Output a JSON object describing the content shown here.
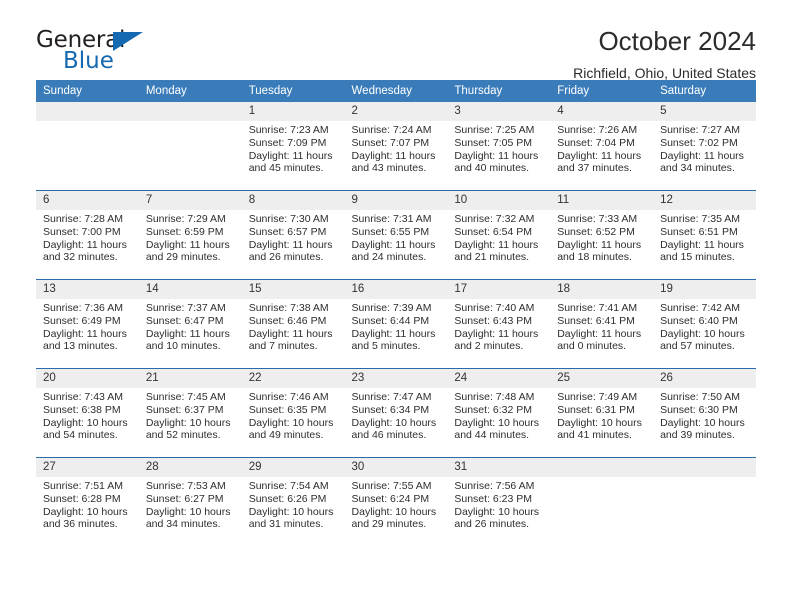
{
  "logo": {
    "word_one": "General",
    "word_two": "Blue",
    "triangle_icon": "triangle-icon",
    "blue": "#1569b0"
  },
  "header": {
    "title": "October 2024",
    "location": "Richfield, Ohio, United States"
  },
  "theme": {
    "header_blue": "#3a7cba",
    "row_rule_blue": "#2b6ca8",
    "daynum_gray": "#eeeeee"
  },
  "calendar": {
    "weekday_headers": [
      "Sunday",
      "Monday",
      "Tuesday",
      "Wednesday",
      "Thursday",
      "Friday",
      "Saturday"
    ],
    "weeks": [
      [
        {
          "day": "",
          "sunrise": "",
          "sunset": "",
          "daylight_a": "",
          "daylight_b": "",
          "empty": true
        },
        {
          "day": "",
          "sunrise": "",
          "sunset": "",
          "daylight_a": "",
          "daylight_b": "",
          "empty": true
        },
        {
          "day": "1",
          "sunrise": "Sunrise: 7:23 AM",
          "sunset": "Sunset: 7:09 PM",
          "daylight_a": "Daylight: 11 hours",
          "daylight_b": "and 45 minutes."
        },
        {
          "day": "2",
          "sunrise": "Sunrise: 7:24 AM",
          "sunset": "Sunset: 7:07 PM",
          "daylight_a": "Daylight: 11 hours",
          "daylight_b": "and 43 minutes."
        },
        {
          "day": "3",
          "sunrise": "Sunrise: 7:25 AM",
          "sunset": "Sunset: 7:05 PM",
          "daylight_a": "Daylight: 11 hours",
          "daylight_b": "and 40 minutes."
        },
        {
          "day": "4",
          "sunrise": "Sunrise: 7:26 AM",
          "sunset": "Sunset: 7:04 PM",
          "daylight_a": "Daylight: 11 hours",
          "daylight_b": "and 37 minutes."
        },
        {
          "day": "5",
          "sunrise": "Sunrise: 7:27 AM",
          "sunset": "Sunset: 7:02 PM",
          "daylight_a": "Daylight: 11 hours",
          "daylight_b": "and 34 minutes."
        }
      ],
      [
        {
          "day": "6",
          "sunrise": "Sunrise: 7:28 AM",
          "sunset": "Sunset: 7:00 PM",
          "daylight_a": "Daylight: 11 hours",
          "daylight_b": "and 32 minutes."
        },
        {
          "day": "7",
          "sunrise": "Sunrise: 7:29 AM",
          "sunset": "Sunset: 6:59 PM",
          "daylight_a": "Daylight: 11 hours",
          "daylight_b": "and 29 minutes."
        },
        {
          "day": "8",
          "sunrise": "Sunrise: 7:30 AM",
          "sunset": "Sunset: 6:57 PM",
          "daylight_a": "Daylight: 11 hours",
          "daylight_b": "and 26 minutes."
        },
        {
          "day": "9",
          "sunrise": "Sunrise: 7:31 AM",
          "sunset": "Sunset: 6:55 PM",
          "daylight_a": "Daylight: 11 hours",
          "daylight_b": "and 24 minutes."
        },
        {
          "day": "10",
          "sunrise": "Sunrise: 7:32 AM",
          "sunset": "Sunset: 6:54 PM",
          "daylight_a": "Daylight: 11 hours",
          "daylight_b": "and 21 minutes."
        },
        {
          "day": "11",
          "sunrise": "Sunrise: 7:33 AM",
          "sunset": "Sunset: 6:52 PM",
          "daylight_a": "Daylight: 11 hours",
          "daylight_b": "and 18 minutes."
        },
        {
          "day": "12",
          "sunrise": "Sunrise: 7:35 AM",
          "sunset": "Sunset: 6:51 PM",
          "daylight_a": "Daylight: 11 hours",
          "daylight_b": "and 15 minutes."
        }
      ],
      [
        {
          "day": "13",
          "sunrise": "Sunrise: 7:36 AM",
          "sunset": "Sunset: 6:49 PM",
          "daylight_a": "Daylight: 11 hours",
          "daylight_b": "and 13 minutes."
        },
        {
          "day": "14",
          "sunrise": "Sunrise: 7:37 AM",
          "sunset": "Sunset: 6:47 PM",
          "daylight_a": "Daylight: 11 hours",
          "daylight_b": "and 10 minutes."
        },
        {
          "day": "15",
          "sunrise": "Sunrise: 7:38 AM",
          "sunset": "Sunset: 6:46 PM",
          "daylight_a": "Daylight: 11 hours",
          "daylight_b": "and 7 minutes."
        },
        {
          "day": "16",
          "sunrise": "Sunrise: 7:39 AM",
          "sunset": "Sunset: 6:44 PM",
          "daylight_a": "Daylight: 11 hours",
          "daylight_b": "and 5 minutes."
        },
        {
          "day": "17",
          "sunrise": "Sunrise: 7:40 AM",
          "sunset": "Sunset: 6:43 PM",
          "daylight_a": "Daylight: 11 hours",
          "daylight_b": "and 2 minutes."
        },
        {
          "day": "18",
          "sunrise": "Sunrise: 7:41 AM",
          "sunset": "Sunset: 6:41 PM",
          "daylight_a": "Daylight: 11 hours",
          "daylight_b": "and 0 minutes."
        },
        {
          "day": "19",
          "sunrise": "Sunrise: 7:42 AM",
          "sunset": "Sunset: 6:40 PM",
          "daylight_a": "Daylight: 10 hours",
          "daylight_b": "and 57 minutes."
        }
      ],
      [
        {
          "day": "20",
          "sunrise": "Sunrise: 7:43 AM",
          "sunset": "Sunset: 6:38 PM",
          "daylight_a": "Daylight: 10 hours",
          "daylight_b": "and 54 minutes."
        },
        {
          "day": "21",
          "sunrise": "Sunrise: 7:45 AM",
          "sunset": "Sunset: 6:37 PM",
          "daylight_a": "Daylight: 10 hours",
          "daylight_b": "and 52 minutes."
        },
        {
          "day": "22",
          "sunrise": "Sunrise: 7:46 AM",
          "sunset": "Sunset: 6:35 PM",
          "daylight_a": "Daylight: 10 hours",
          "daylight_b": "and 49 minutes."
        },
        {
          "day": "23",
          "sunrise": "Sunrise: 7:47 AM",
          "sunset": "Sunset: 6:34 PM",
          "daylight_a": "Daylight: 10 hours",
          "daylight_b": "and 46 minutes."
        },
        {
          "day": "24",
          "sunrise": "Sunrise: 7:48 AM",
          "sunset": "Sunset: 6:32 PM",
          "daylight_a": "Daylight: 10 hours",
          "daylight_b": "and 44 minutes."
        },
        {
          "day": "25",
          "sunrise": "Sunrise: 7:49 AM",
          "sunset": "Sunset: 6:31 PM",
          "daylight_a": "Daylight: 10 hours",
          "daylight_b": "and 41 minutes."
        },
        {
          "day": "26",
          "sunrise": "Sunrise: 7:50 AM",
          "sunset": "Sunset: 6:30 PM",
          "daylight_a": "Daylight: 10 hours",
          "daylight_b": "and 39 minutes."
        }
      ],
      [
        {
          "day": "27",
          "sunrise": "Sunrise: 7:51 AM",
          "sunset": "Sunset: 6:28 PM",
          "daylight_a": "Daylight: 10 hours",
          "daylight_b": "and 36 minutes."
        },
        {
          "day": "28",
          "sunrise": "Sunrise: 7:53 AM",
          "sunset": "Sunset: 6:27 PM",
          "daylight_a": "Daylight: 10 hours",
          "daylight_b": "and 34 minutes."
        },
        {
          "day": "29",
          "sunrise": "Sunrise: 7:54 AM",
          "sunset": "Sunset: 6:26 PM",
          "daylight_a": "Daylight: 10 hours",
          "daylight_b": "and 31 minutes."
        },
        {
          "day": "30",
          "sunrise": "Sunrise: 7:55 AM",
          "sunset": "Sunset: 6:24 PM",
          "daylight_a": "Daylight: 10 hours",
          "daylight_b": "and 29 minutes."
        },
        {
          "day": "31",
          "sunrise": "Sunrise: 7:56 AM",
          "sunset": "Sunset: 6:23 PM",
          "daylight_a": "Daylight: 10 hours",
          "daylight_b": "and 26 minutes."
        },
        {
          "day": "",
          "sunrise": "",
          "sunset": "",
          "daylight_a": "",
          "daylight_b": "",
          "empty": true
        },
        {
          "day": "",
          "sunrise": "",
          "sunset": "",
          "daylight_a": "",
          "daylight_b": "",
          "empty": true
        }
      ]
    ]
  }
}
